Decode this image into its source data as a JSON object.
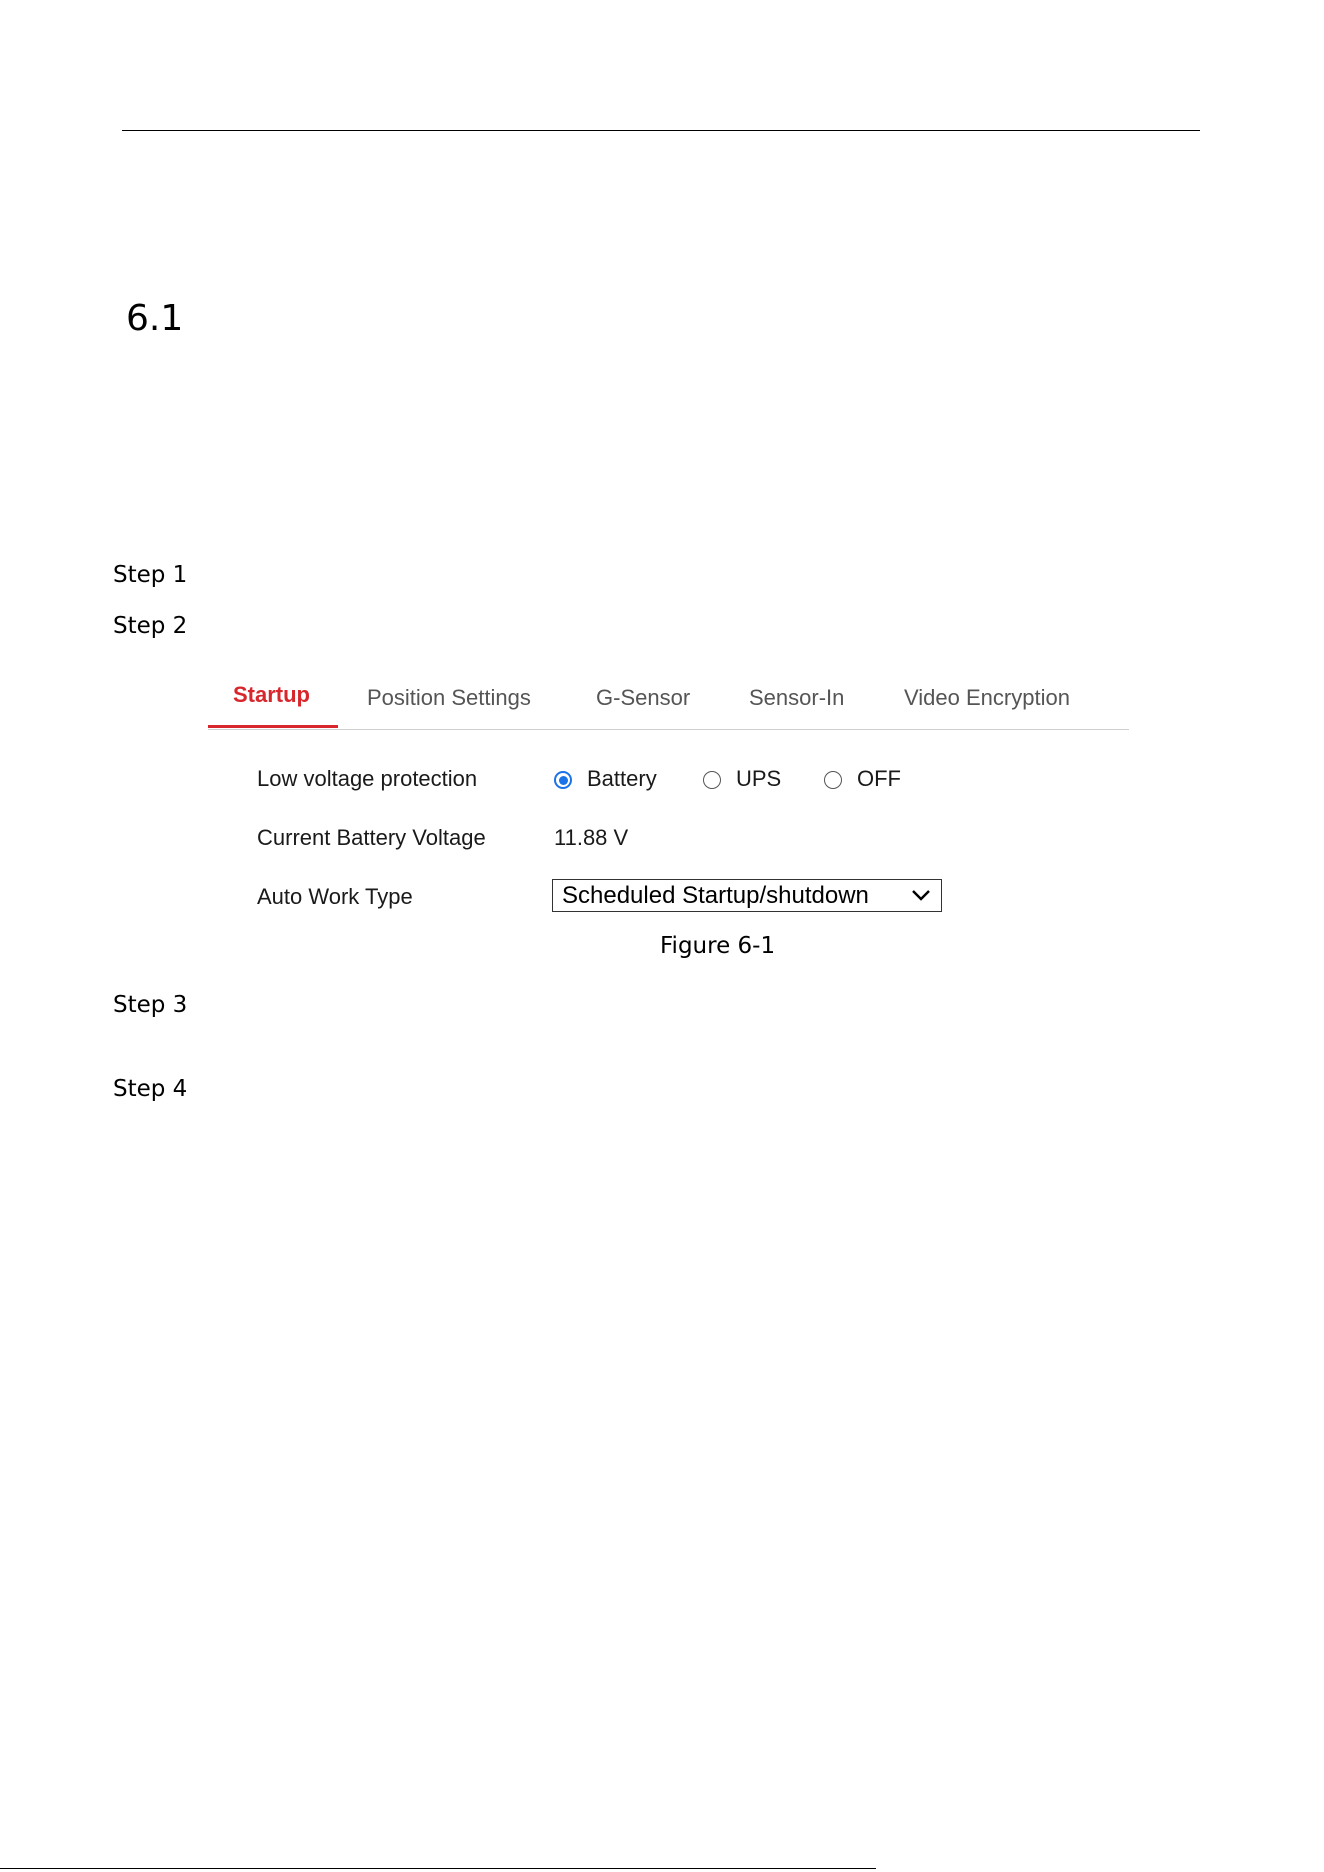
{
  "heading": {
    "number": "6.1"
  },
  "steps": [
    "Step 1",
    "Step 2",
    "Step 3",
    "Step 4"
  ],
  "tabs": [
    "Startup",
    "Position Settings",
    "G-Sensor",
    "Sensor-In",
    "Video Encryption"
  ],
  "active_tab": "Startup",
  "form": {
    "low_voltage_label": "Low voltage protection",
    "options": [
      "Battery",
      "UPS",
      "OFF"
    ],
    "selected_option": "Battery",
    "battery_voltage_label": "Current Battery Voltage",
    "battery_voltage_value": "11.88 V",
    "auto_work_type_label": "Auto Work Type",
    "auto_work_type_value": "Scheduled Startup/shutdown"
  },
  "caption": "Figure 6-1",
  "colors": {
    "active_tab": "#d8262d",
    "radio_selected": "#1a73e8"
  }
}
